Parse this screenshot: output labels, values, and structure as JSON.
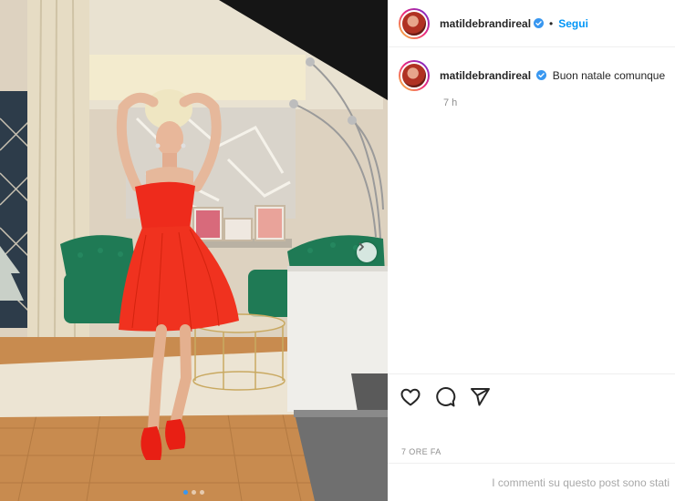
{
  "post": {
    "username": "matildebrandireal",
    "follow_label": "Segui",
    "separator": "•",
    "caption": "Buon natale comunque",
    "caption_time": "7 h",
    "date": "7 ORE FA",
    "comments_disabled": "I commenti su questo post sono stati",
    "carousel": {
      "total_slides": 3,
      "active_slide": 1
    }
  },
  "colors": {
    "accent": "#0095f6",
    "dress": "#ee2b1c",
    "chairs": "#1f7a55"
  },
  "icons": [
    "verified-badge-icon",
    "heart-icon",
    "comment-icon",
    "share-icon",
    "chevron-right-icon"
  ]
}
